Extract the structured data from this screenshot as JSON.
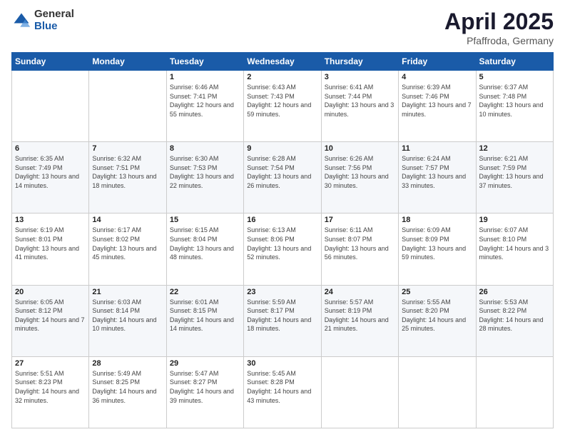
{
  "header": {
    "logo_general": "General",
    "logo_blue": "Blue",
    "month_title": "April 2025",
    "location": "Pfaffroda, Germany"
  },
  "weekdays": [
    "Sunday",
    "Monday",
    "Tuesday",
    "Wednesday",
    "Thursday",
    "Friday",
    "Saturday"
  ],
  "weeks": [
    [
      {
        "day": "",
        "sunrise": "",
        "sunset": "",
        "daylight": ""
      },
      {
        "day": "",
        "sunrise": "",
        "sunset": "",
        "daylight": ""
      },
      {
        "day": "1",
        "sunrise": "Sunrise: 6:46 AM",
        "sunset": "Sunset: 7:41 PM",
        "daylight": "Daylight: 12 hours and 55 minutes."
      },
      {
        "day": "2",
        "sunrise": "Sunrise: 6:43 AM",
        "sunset": "Sunset: 7:43 PM",
        "daylight": "Daylight: 12 hours and 59 minutes."
      },
      {
        "day": "3",
        "sunrise": "Sunrise: 6:41 AM",
        "sunset": "Sunset: 7:44 PM",
        "daylight": "Daylight: 13 hours and 3 minutes."
      },
      {
        "day": "4",
        "sunrise": "Sunrise: 6:39 AM",
        "sunset": "Sunset: 7:46 PM",
        "daylight": "Daylight: 13 hours and 7 minutes."
      },
      {
        "day": "5",
        "sunrise": "Sunrise: 6:37 AM",
        "sunset": "Sunset: 7:48 PM",
        "daylight": "Daylight: 13 hours and 10 minutes."
      }
    ],
    [
      {
        "day": "6",
        "sunrise": "Sunrise: 6:35 AM",
        "sunset": "Sunset: 7:49 PM",
        "daylight": "Daylight: 13 hours and 14 minutes."
      },
      {
        "day": "7",
        "sunrise": "Sunrise: 6:32 AM",
        "sunset": "Sunset: 7:51 PM",
        "daylight": "Daylight: 13 hours and 18 minutes."
      },
      {
        "day": "8",
        "sunrise": "Sunrise: 6:30 AM",
        "sunset": "Sunset: 7:53 PM",
        "daylight": "Daylight: 13 hours and 22 minutes."
      },
      {
        "day": "9",
        "sunrise": "Sunrise: 6:28 AM",
        "sunset": "Sunset: 7:54 PM",
        "daylight": "Daylight: 13 hours and 26 minutes."
      },
      {
        "day": "10",
        "sunrise": "Sunrise: 6:26 AM",
        "sunset": "Sunset: 7:56 PM",
        "daylight": "Daylight: 13 hours and 30 minutes."
      },
      {
        "day": "11",
        "sunrise": "Sunrise: 6:24 AM",
        "sunset": "Sunset: 7:57 PM",
        "daylight": "Daylight: 13 hours and 33 minutes."
      },
      {
        "day": "12",
        "sunrise": "Sunrise: 6:21 AM",
        "sunset": "Sunset: 7:59 PM",
        "daylight": "Daylight: 13 hours and 37 minutes."
      }
    ],
    [
      {
        "day": "13",
        "sunrise": "Sunrise: 6:19 AM",
        "sunset": "Sunset: 8:01 PM",
        "daylight": "Daylight: 13 hours and 41 minutes."
      },
      {
        "day": "14",
        "sunrise": "Sunrise: 6:17 AM",
        "sunset": "Sunset: 8:02 PM",
        "daylight": "Daylight: 13 hours and 45 minutes."
      },
      {
        "day": "15",
        "sunrise": "Sunrise: 6:15 AM",
        "sunset": "Sunset: 8:04 PM",
        "daylight": "Daylight: 13 hours and 48 minutes."
      },
      {
        "day": "16",
        "sunrise": "Sunrise: 6:13 AM",
        "sunset": "Sunset: 8:06 PM",
        "daylight": "Daylight: 13 hours and 52 minutes."
      },
      {
        "day": "17",
        "sunrise": "Sunrise: 6:11 AM",
        "sunset": "Sunset: 8:07 PM",
        "daylight": "Daylight: 13 hours and 56 minutes."
      },
      {
        "day": "18",
        "sunrise": "Sunrise: 6:09 AM",
        "sunset": "Sunset: 8:09 PM",
        "daylight": "Daylight: 13 hours and 59 minutes."
      },
      {
        "day": "19",
        "sunrise": "Sunrise: 6:07 AM",
        "sunset": "Sunset: 8:10 PM",
        "daylight": "Daylight: 14 hours and 3 minutes."
      }
    ],
    [
      {
        "day": "20",
        "sunrise": "Sunrise: 6:05 AM",
        "sunset": "Sunset: 8:12 PM",
        "daylight": "Daylight: 14 hours and 7 minutes."
      },
      {
        "day": "21",
        "sunrise": "Sunrise: 6:03 AM",
        "sunset": "Sunset: 8:14 PM",
        "daylight": "Daylight: 14 hours and 10 minutes."
      },
      {
        "day": "22",
        "sunrise": "Sunrise: 6:01 AM",
        "sunset": "Sunset: 8:15 PM",
        "daylight": "Daylight: 14 hours and 14 minutes."
      },
      {
        "day": "23",
        "sunrise": "Sunrise: 5:59 AM",
        "sunset": "Sunset: 8:17 PM",
        "daylight": "Daylight: 14 hours and 18 minutes."
      },
      {
        "day": "24",
        "sunrise": "Sunrise: 5:57 AM",
        "sunset": "Sunset: 8:19 PM",
        "daylight": "Daylight: 14 hours and 21 minutes."
      },
      {
        "day": "25",
        "sunrise": "Sunrise: 5:55 AM",
        "sunset": "Sunset: 8:20 PM",
        "daylight": "Daylight: 14 hours and 25 minutes."
      },
      {
        "day": "26",
        "sunrise": "Sunrise: 5:53 AM",
        "sunset": "Sunset: 8:22 PM",
        "daylight": "Daylight: 14 hours and 28 minutes."
      }
    ],
    [
      {
        "day": "27",
        "sunrise": "Sunrise: 5:51 AM",
        "sunset": "Sunset: 8:23 PM",
        "daylight": "Daylight: 14 hours and 32 minutes."
      },
      {
        "day": "28",
        "sunrise": "Sunrise: 5:49 AM",
        "sunset": "Sunset: 8:25 PM",
        "daylight": "Daylight: 14 hours and 36 minutes."
      },
      {
        "day": "29",
        "sunrise": "Sunrise: 5:47 AM",
        "sunset": "Sunset: 8:27 PM",
        "daylight": "Daylight: 14 hours and 39 minutes."
      },
      {
        "day": "30",
        "sunrise": "Sunrise: 5:45 AM",
        "sunset": "Sunset: 8:28 PM",
        "daylight": "Daylight: 14 hours and 43 minutes."
      },
      {
        "day": "",
        "sunrise": "",
        "sunset": "",
        "daylight": ""
      },
      {
        "day": "",
        "sunrise": "",
        "sunset": "",
        "daylight": ""
      },
      {
        "day": "",
        "sunrise": "",
        "sunset": "",
        "daylight": ""
      }
    ]
  ]
}
